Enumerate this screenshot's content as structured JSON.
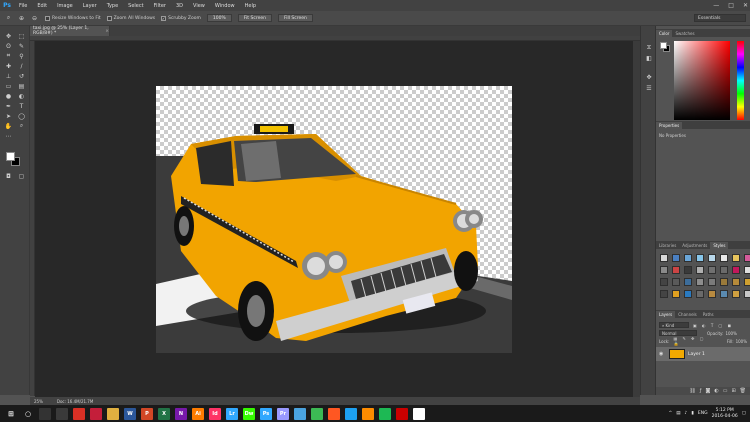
{
  "app": {
    "logo": "Ps",
    "accent": "#31a8ff"
  },
  "menu": [
    "File",
    "Edit",
    "Image",
    "Layer",
    "Type",
    "Select",
    "Filter",
    "3D",
    "View",
    "Window",
    "Help"
  ],
  "window_controls": [
    "—",
    "□",
    "✕"
  ],
  "options": {
    "resize_windows_label": "Resize Windows to Fit",
    "zoom_all_label": "Zoom All Windows",
    "scrubby_zoom_label": "Scrubby Zoom",
    "btn_100": "100%",
    "btn_fit": "Fit Screen",
    "btn_fill": "Fill Screen",
    "workspace": "Essentials"
  },
  "document": {
    "tab_title": "taxi.jpg @ 25% (Layer 1, RGB/8#) *",
    "close_glyph": "×",
    "zoom": "25%",
    "doc_info": "Doc: 16.4M/21.7M"
  },
  "panels": {
    "color_tabs": [
      "Color",
      "Swatches"
    ],
    "properties_tab": "Properties",
    "properties_body": "No Properties",
    "styles_tabs": [
      "Libraries",
      "Adjustments",
      "Styles"
    ],
    "layers_tabs": [
      "Layers",
      "Channels",
      "Paths"
    ],
    "kind_label": "Kind",
    "blend_mode": "Normal",
    "opacity_label": "Opacity:",
    "opacity_value": "100%",
    "lock_label": "Lock:",
    "fill_label": "Fill:",
    "fill_value": "100%",
    "layer_name": "Layer 1"
  },
  "style_swatches": [
    "#d9d9d9",
    "#4a7fc1",
    "#6aa6d8",
    "#87c6ea",
    "#b8d7ea",
    "#e8e8e8",
    "#e6c35c",
    "#d45a9a",
    "#8a8a8a",
    "#c44",
    "#3a3a3a",
    "#b0b0b0",
    "#707070",
    "#6a6a6a",
    "#c2185b",
    "#e0e0e0",
    "#444",
    "#5a5a5a",
    "#3d6d9a",
    "#8d8d8d",
    "#7a7a7a",
    "#9a7a3a",
    "#b58a3a",
    "#cfa030",
    "#444",
    "#e0a020",
    "#2a7ac0",
    "#6a6a6a",
    "#b88a40",
    "#5a8ab0",
    "#d0a040",
    "#c8c8c8"
  ],
  "taskbar": {
    "apps": [
      {
        "label": "",
        "color": "#333333"
      },
      {
        "label": "",
        "color": "#3a3a3a"
      },
      {
        "label": "",
        "color": "#d93025"
      },
      {
        "label": "",
        "color": "#c41e3a"
      },
      {
        "label": "",
        "color": "#e0b040"
      },
      {
        "label": "W",
        "color": "#2b579a"
      },
      {
        "label": "P",
        "color": "#d24726"
      },
      {
        "label": "X",
        "color": "#217346"
      },
      {
        "label": "N",
        "color": "#7719aa"
      },
      {
        "label": "Ai",
        "color": "#ff7c00"
      },
      {
        "label": "Id",
        "color": "#ff3366"
      },
      {
        "label": "Lr",
        "color": "#31a8ff"
      },
      {
        "label": "Dw",
        "color": "#35fa00"
      },
      {
        "label": "Ps",
        "color": "#31a8ff"
      },
      {
        "label": "Pr",
        "color": "#9999ff"
      },
      {
        "label": "",
        "color": "#4aa3df"
      },
      {
        "label": "",
        "color": "#3cba54"
      },
      {
        "label": "",
        "color": "#ff5722"
      },
      {
        "label": "",
        "color": "#1da1f2"
      },
      {
        "label": "",
        "color": "#ff8c00"
      },
      {
        "label": "",
        "color": "#1db954"
      },
      {
        "label": "",
        "color": "#c00"
      },
      {
        "label": "",
        "color": "#ffffff"
      }
    ],
    "language": "ENG",
    "time": "5:12 PM",
    "date": "2016-04-06"
  }
}
